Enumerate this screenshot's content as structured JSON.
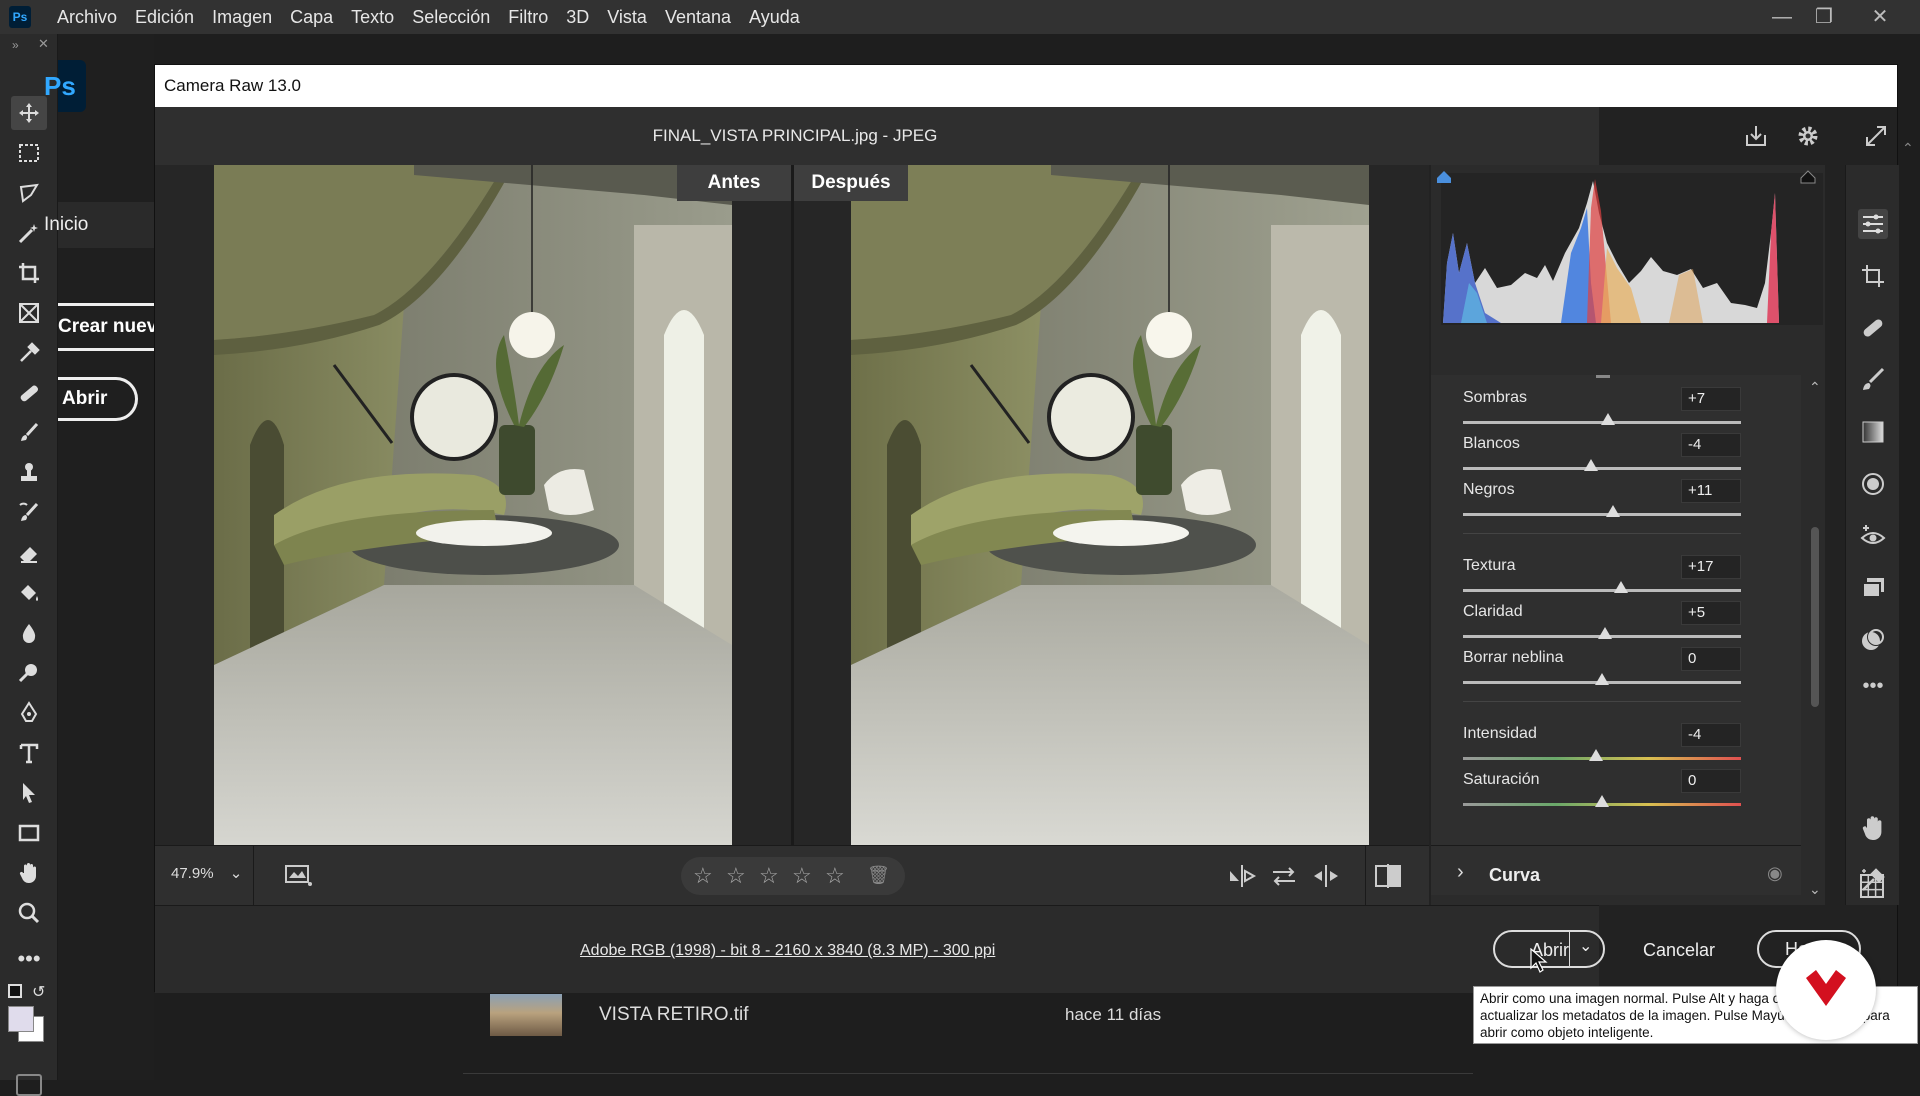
{
  "menubar": {
    "app_logo": "Ps",
    "items": [
      "Archivo",
      "Edición",
      "Imagen",
      "Capa",
      "Texto",
      "Selección",
      "Filtro",
      "3D",
      "Vista",
      "Ventana",
      "Ayuda"
    ]
  },
  "home": {
    "logo": "Ps",
    "inicio_label": "Inicio",
    "crear_label": "Crear nuevo",
    "abrir_label": "Abrir"
  },
  "recent": {
    "file_name": "VISTA RETIRO.tif",
    "date": "hace 11 días"
  },
  "camera_raw": {
    "title": "Camera Raw 13.0",
    "file_label": "FINAL_VISTA PRINCIPAL.jpg -  JPEG",
    "before_label": "Antes",
    "after_label": "Después",
    "zoom": "47.9%",
    "workflow": "Adobe RGB (1998) - bit 8 - 2160 x 3840 (8.3 MP) - 300 ppi",
    "open_label": "Abrir",
    "cancel_label": "Cancelar",
    "done_label": "Hecho",
    "curve_section": "Curva"
  },
  "sliders": [
    {
      "label": "Sombras",
      "value": "+7",
      "pos": 0.52
    },
    {
      "label": "Blancos",
      "value": "-4",
      "pos": 0.46
    },
    {
      "label": "Negros",
      "value": "+11",
      "pos": 0.54
    },
    {
      "label": "Textura",
      "value": "+17",
      "pos": 0.57
    },
    {
      "label": "Claridad",
      "value": "+5",
      "pos": 0.51
    },
    {
      "label": "Borrar neblina",
      "value": "0",
      "pos": 0.5
    },
    {
      "label": "Intensidad",
      "value": "-4",
      "pos": 0.48
    },
    {
      "label": "Saturación",
      "value": "0",
      "pos": 0.5
    }
  ],
  "tooltip": {
    "text": "Abrir como una imagen normal. Pulse Alt y haga clic para abrir sin actualizar los metadatos de la imagen.  Pulse Mayús y haga clic para abrir como objeto inteligente."
  },
  "colors": {
    "accent": "#31a8ff",
    "brand_badge": "#d3101f"
  }
}
